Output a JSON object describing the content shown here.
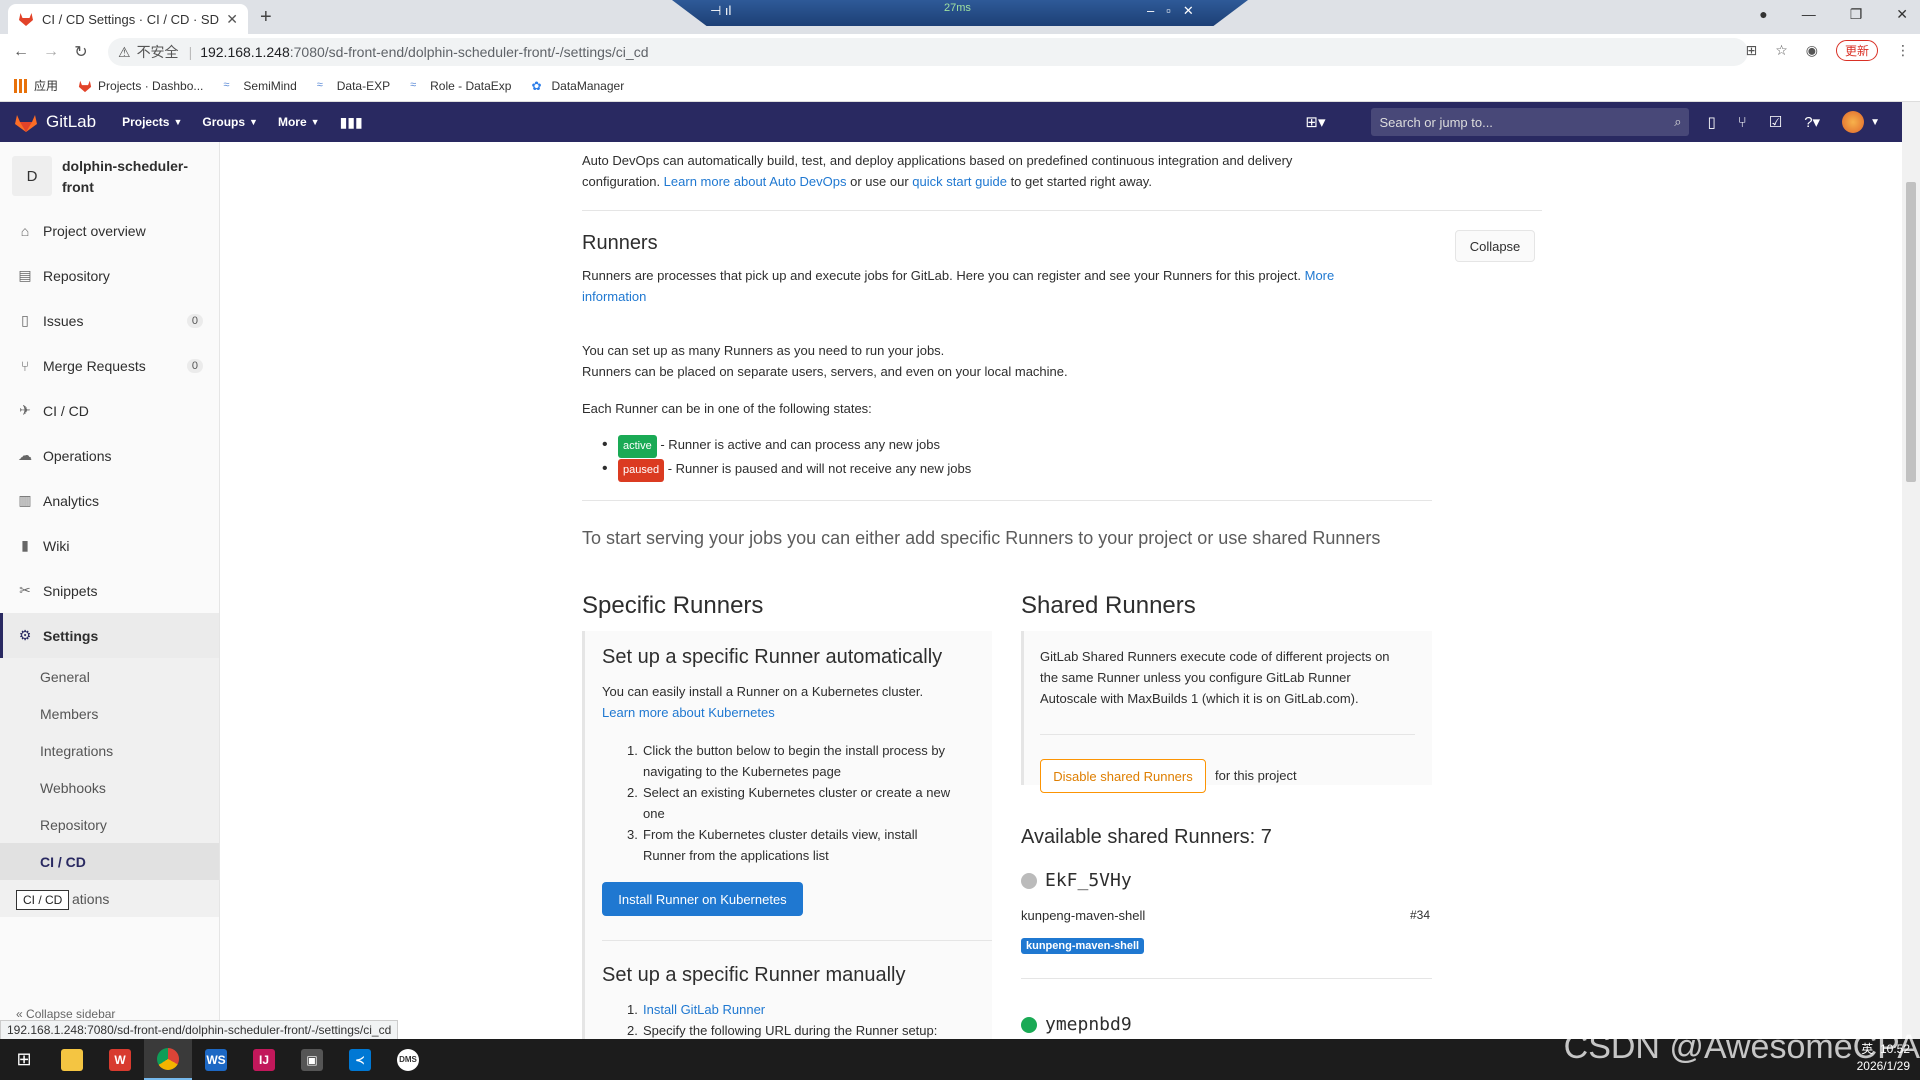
{
  "browser": {
    "tab_title": "CI / CD Settings · CI / CD · SD",
    "remote_latency": "27ms",
    "insecure_label": "不安全",
    "url_host": "192.168.1.248",
    "url_path": ":7080/sd-front-end/dolphin-scheduler-front/-/settings/ci_cd",
    "update_label": "更新",
    "bookmarks": [
      "应用",
      "Projects · Dashbo...",
      "SemiMind",
      "Data-EXP",
      "Role - DataExp",
      "DataManager"
    ],
    "status_link": "192.168.1.248:7080/sd-front-end/dolphin-scheduler-front/-/settings/ci_cd"
  },
  "gitlab": {
    "brand": "GitLab",
    "nav": {
      "projects": "Projects",
      "groups": "Groups",
      "more": "More"
    },
    "search_placeholder": "Search or jump to..."
  },
  "sidebar": {
    "project_letter": "D",
    "project_name": "dolphin-scheduler-front",
    "items": {
      "overview": "Project overview",
      "repository": "Repository",
      "issues": "Issues",
      "issues_count": "0",
      "merge_requests": "Merge Requests",
      "mr_count": "0",
      "cicd": "CI / CD",
      "operations": "Operations",
      "analytics": "Analytics",
      "wiki": "Wiki",
      "snippets": "Snippets",
      "settings": "Settings"
    },
    "sub": {
      "general": "General",
      "members": "Members",
      "integrations": "Integrations",
      "webhooks": "Webhooks",
      "repository": "Repository",
      "cicd": "CI / CD",
      "operations_tail": "ations"
    },
    "tooltip": "CI / CD",
    "collapse": "Collapse sidebar"
  },
  "content": {
    "autodevops_1": "Auto DevOps can automatically build, test, and deploy applications based on predefined continuous integration and delivery",
    "autodevops_2a": "configuration. ",
    "autodevops_link1": "Learn more about Auto DevOps",
    "autodevops_2b": " or use our ",
    "autodevops_link2": "quick start guide",
    "autodevops_2c": " to get started right away.",
    "runners_title": "Runners",
    "collapse_btn": "Collapse",
    "runners_desc": "Runners are processes that pick up and execute jobs for GitLab. Here you can register and see your Runners for this project. ",
    "runners_more_1": "More",
    "runners_more_2": "information",
    "setup_1": "You can set up as many Runners as you need to run your jobs.",
    "setup_2": "Runners can be placed on separate users, servers, and even on your local machine.",
    "states_intro": "Each Runner can be in one of the following states:",
    "state_active": "active",
    "state_active_desc": " - Runner is active and can process any new jobs",
    "state_paused": "paused",
    "state_paused_desc": " - Runner is paused and will not receive any new jobs",
    "lead": "To start serving your jobs you can either add specific Runners to your project or use shared Runners",
    "specific_title": "Specific Runners",
    "shared_title": "Shared Runners",
    "auto_title": "Set up a specific Runner automatically",
    "auto_desc": "You can easily install a Runner on a Kubernetes cluster.",
    "auto_link": "Learn more about Kubernetes",
    "auto_steps": [
      [
        "1.",
        "Click the button below to begin the install process by"
      ],
      [
        "",
        "navigating to the Kubernetes page"
      ],
      [
        "2.",
        "Select an existing Kubernetes cluster or create a new"
      ],
      [
        "",
        "one"
      ],
      [
        "3.",
        "From the Kubernetes cluster details view, install"
      ],
      [
        "",
        "Runner from the applications list"
      ]
    ],
    "install_btn": "Install Runner on Kubernetes",
    "manual_title": "Set up a specific Runner manually",
    "manual_step1_num": "1.",
    "manual_step1": "Install GitLab Runner",
    "manual_step2_num": "2.",
    "manual_step2": "Specify the following URL during the Runner setup:",
    "shared_desc_1": "GitLab Shared Runners execute code of different projects on",
    "shared_desc_2": "the same Runner unless you configure GitLab Runner",
    "shared_desc_3": "Autoscale with MaxBuilds 1 (which it is on GitLab.com).",
    "disable_btn": "Disable shared Runners",
    "for_project": "for this project",
    "available": "Available shared Runners: 7",
    "runner1_name": "EkF_5VHy",
    "runner1_desc": "kunpeng-maven-shell",
    "runner1_id": "#34",
    "runner1_tag": "kunpeng-maven-shell",
    "runner2_name": "ymepnbd9"
  },
  "taskbar": {
    "time": "10:52",
    "date": "2026/1/29",
    "ime": "英"
  },
  "watermark": "CSDN @AwesomeCPA",
  "colors": {
    "gitlab_header": "#292961",
    "link": "#1f78d1",
    "active": "#1aaa55",
    "paused": "#db3b21",
    "warning": "#fc9403"
  }
}
